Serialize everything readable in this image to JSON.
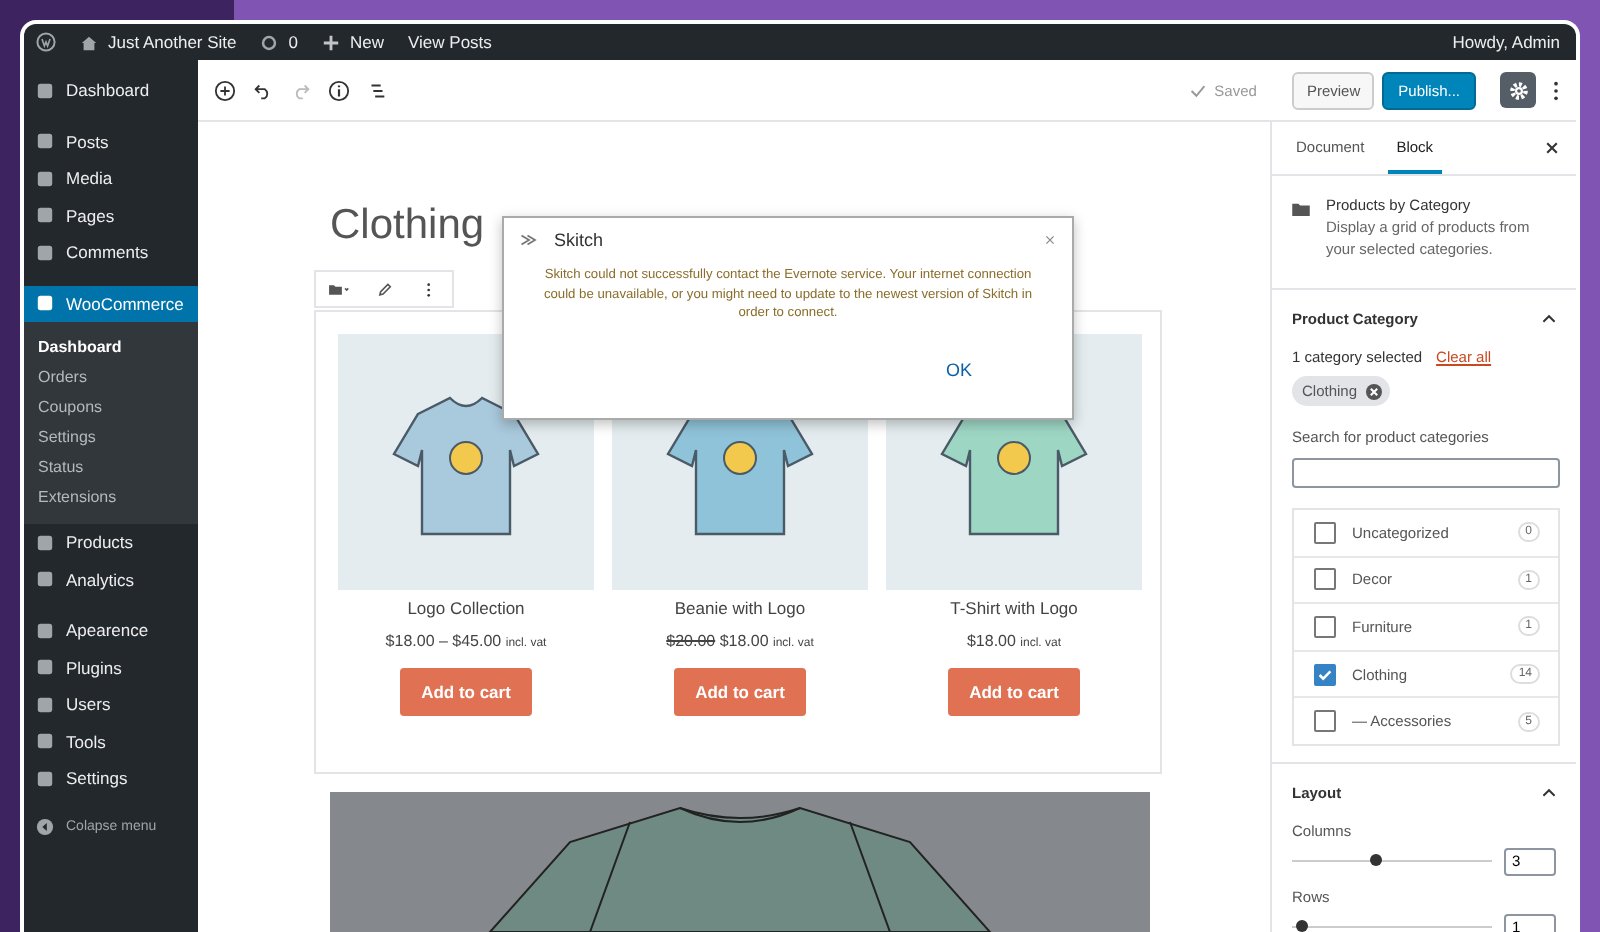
{
  "admin_bar": {
    "site": "Just Another Site",
    "comments": "0",
    "new": "New",
    "view": "View Posts",
    "greeting": "Howdy, Admin"
  },
  "menu_groups": [
    [
      {
        "label": "Dashboard",
        "selected": false
      }
    ],
    [
      {
        "label": "Posts",
        "selected": false
      },
      {
        "label": "Media",
        "selected": false
      },
      {
        "label": "Pages",
        "selected": false
      },
      {
        "label": "Comments",
        "selected": false
      }
    ],
    [
      {
        "label": "WooCommerce",
        "selected": true,
        "children": [
          {
            "label": "Dashboard",
            "selected": true
          },
          {
            "label": "Orders",
            "selected": false
          },
          {
            "label": "Coupons",
            "selected": false
          },
          {
            "label": "Settings",
            "selected": false
          },
          {
            "label": "Status",
            "selected": false
          },
          {
            "label": "Extensions",
            "selected": false
          }
        ]
      },
      {
        "label": "Products",
        "selected": false
      },
      {
        "label": "Analytics",
        "selected": false
      }
    ],
    [
      {
        "label": "Apearence",
        "selected": false
      },
      {
        "label": "Plugins",
        "selected": false
      },
      {
        "label": "Users",
        "selected": false
      },
      {
        "label": "Tools",
        "selected": false
      },
      {
        "label": "Settings",
        "selected": false
      }
    ]
  ],
  "collapse": "Colapse menu",
  "toolbar": {
    "saved": "Saved",
    "preview": "Preview",
    "publish": "Publish..."
  },
  "post_title": "Clothing",
  "products": [
    {
      "name": "Logo Collection",
      "price": "$18.00 – $45.00",
      "tax": "incl. vat",
      "button": "Add to cart"
    },
    {
      "name": "Beanie with Logo",
      "old_price": "$20.00",
      "price": "$18.00",
      "tax": "incl. vat",
      "button": "Add to cart"
    },
    {
      "name": "T-Shirt with Logo",
      "price": "$18.00",
      "tax": "incl. vat",
      "button": "Add to cart"
    }
  ],
  "dialog": {
    "title": "Skitch",
    "message": "Skitch could not successfully contact the Evernote service. Your internet connection could be unavailable, or you might need to update to the newest version of Skitch in order to connect.",
    "button": "OK"
  },
  "panel": {
    "tabs": [
      {
        "label": "Document",
        "selected": false
      },
      {
        "label": "Block",
        "selected": true
      }
    ],
    "block": {
      "name": "Products by Category",
      "description": "Display a grid of products from your selected categories."
    },
    "category": {
      "title": "Product Category",
      "expanded": true,
      "count_text": "1 category selected",
      "clear": "Clear all",
      "chip": "Clothing",
      "search_label": "Search for product categories",
      "items": [
        {
          "label": "Uncategorized",
          "count": "0",
          "checked": false
        },
        {
          "label": "Decor",
          "count": "1",
          "checked": false
        },
        {
          "label": "Furniture",
          "count": "1",
          "checked": false
        },
        {
          "label": "Clothing",
          "count": "14",
          "checked": true
        },
        {
          "label": "— Accessories",
          "count": "5",
          "checked": false
        }
      ]
    },
    "layout": {
      "title": "Layout",
      "expanded": true,
      "controls": [
        {
          "label": "Columns",
          "level": 0.42,
          "value": "3"
        },
        {
          "label": "Rows",
          "level": 0.05,
          "value": "1"
        }
      ]
    }
  }
}
